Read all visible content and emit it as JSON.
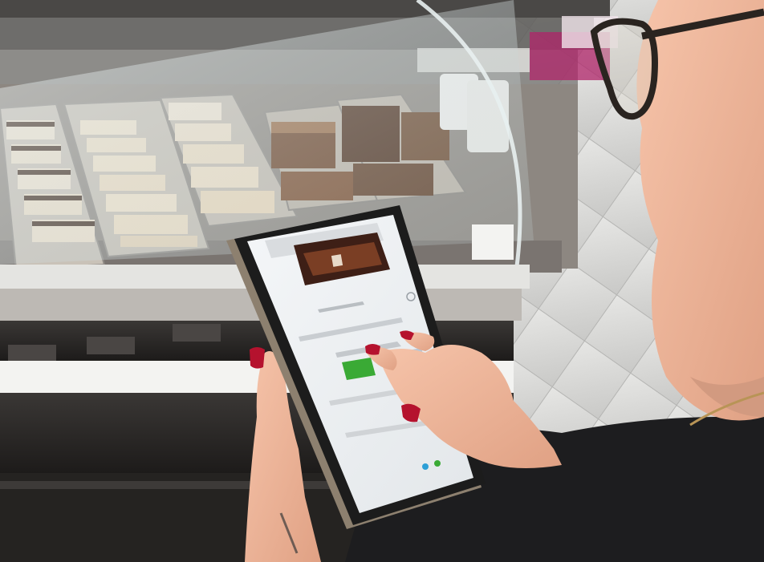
{
  "scene": {
    "colors": {
      "counter_dark": "#2b2927",
      "glass_tint": "#c9d4d4",
      "tile_floor": "#d9d9d7",
      "tablet_bezel": "#1c1c1c",
      "tablet_screen": "#eef0f2",
      "screen_green_button": "#3aaa35",
      "screen_banner": "#3e1f16",
      "skin": "#f2b79a",
      "nail_polish": "#b5122e",
      "shirt": "#1d1d1f",
      "glasses_frame": "#2a2420"
    },
    "icons": [
      "pastry-tray",
      "tablet",
      "green-button",
      "hand",
      "eyeglasses"
    ]
  }
}
